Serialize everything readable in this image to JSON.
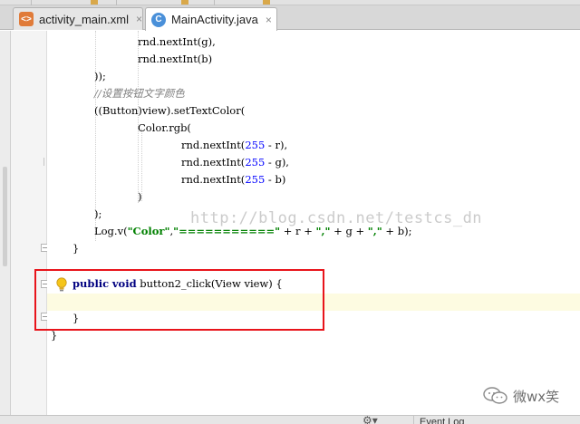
{
  "tabs": [
    {
      "label": "activity_main.xml",
      "icon": "xml-file-icon",
      "icon_glyph": "<>",
      "icon_color": "#e07b39",
      "active": false
    },
    {
      "label": "MainActivity.java",
      "icon": "java-class-icon",
      "icon_glyph": "C",
      "icon_color": "#4a90d9",
      "active": true
    }
  ],
  "tab_close_glyph": "×",
  "code": {
    "lines": [
      "rnd.nextInt(g),",
      "rnd.nextInt(b)",
      "));",
      "//设置按钮文字颜色",
      "((Button)view).setTextColor(",
      "Color.rgb(",
      "rnd.nextInt(255 - r),",
      "rnd.nextInt(255 - g),",
      "rnd.nextInt(255 - b)",
      ")",
      ");",
      "Log.v(\"Color\",\"===========\" + r + \",\" + g + \",\" + b);",
      "}",
      "",
      "public void button2_click(View view) {",
      "",
      "}",
      "}"
    ]
  },
  "watermark": "http://blog.csdn.net/testcs_dn",
  "status_bar": {
    "event_log_label": "Event Log"
  },
  "wechat_label": "微wx笑",
  "colors": {
    "keyword": "#000080",
    "string": "#008000",
    "number": "#0000ff",
    "comment": "#808080",
    "highlight_box": "#e8141b",
    "caret_row": "#fdfbe1"
  }
}
